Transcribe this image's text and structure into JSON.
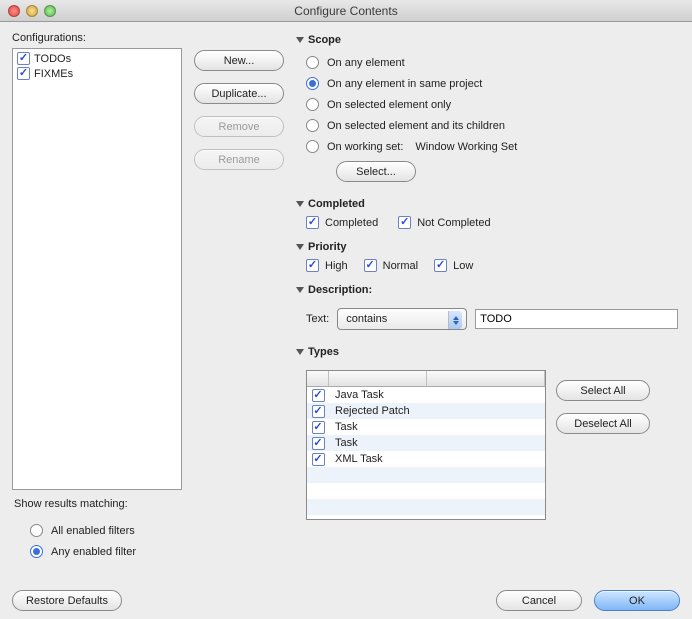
{
  "window": {
    "title": "Configure Contents"
  },
  "left": {
    "label": "Configurations:",
    "items": [
      {
        "label": "TODOs",
        "checked": true
      },
      {
        "label": "FIXMEs",
        "checked": true
      }
    ],
    "showResults": "Show results matching:",
    "matchAll": "All enabled filters",
    "matchAny": "Any enabled filter"
  },
  "buttons": {
    "new": "New...",
    "duplicate": "Duplicate...",
    "remove": "Remove",
    "rename": "Rename",
    "selectAll": "Select All",
    "deselectAll": "Deselect All",
    "restore": "Restore Defaults",
    "cancel": "Cancel",
    "ok": "OK",
    "select": "Select..."
  },
  "scope": {
    "title": "Scope",
    "any": "On any element",
    "project": "On any element in same project",
    "selected": "On selected element only",
    "children": "On selected element and its children",
    "workingSet": "On working set:",
    "workingSetValue": "Window Working Set"
  },
  "completed": {
    "title": "Completed",
    "completed": "Completed",
    "notCompleted": "Not Completed"
  },
  "priority": {
    "title": "Priority",
    "high": "High",
    "normal": "Normal",
    "low": "Low"
  },
  "description": {
    "title": "Description:",
    "textLabel": "Text:",
    "mode": "contains",
    "value": "TODO"
  },
  "types": {
    "title": "Types",
    "rows": [
      {
        "label": "Java Task",
        "checked": true
      },
      {
        "label": "Rejected Patch",
        "checked": true
      },
      {
        "label": "Task",
        "checked": true
      },
      {
        "label": "Task",
        "checked": true
      },
      {
        "label": "XML Task",
        "checked": true
      }
    ]
  }
}
